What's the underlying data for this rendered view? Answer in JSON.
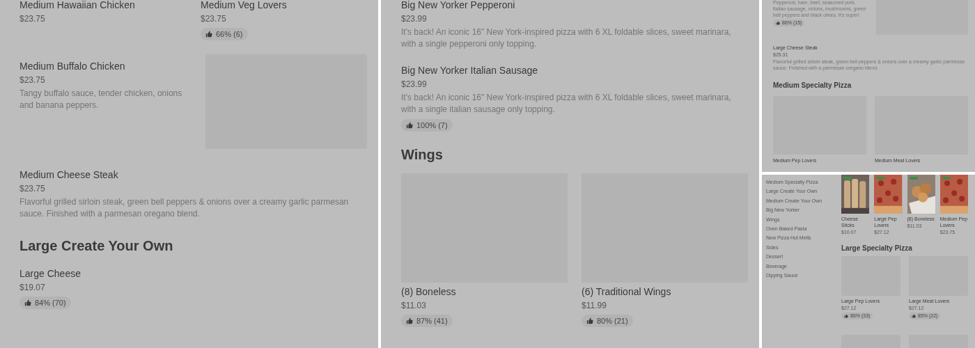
{
  "left_panel": {
    "blocks": [
      {
        "kind": "pair",
        "items": [
          {
            "name": "Medium Hawaiian Chicken",
            "price": "$23.75"
          },
          {
            "name": "Medium Veg Lovers",
            "price": "$23.75",
            "rating": "66% (6)"
          }
        ]
      },
      {
        "kind": "item_with_image",
        "name": "Medium Buffalo Chicken",
        "price": "$23.75",
        "description": "Tangy buffalo sauce, tender chicken, onions and banana peppers."
      },
      {
        "kind": "item",
        "name": "Medium Cheese Steak",
        "price": "$23.75",
        "description": "Flavorful grilled sirloin steak, green bell peppers & onions over a creamy garlic parmesan sauce. Finished with a parmesan oregano blend."
      },
      {
        "kind": "heading",
        "text": "Large Create Your Own"
      },
      {
        "kind": "item",
        "name": "Large Cheese",
        "price": "$19.07",
        "rating": "84% (70)"
      }
    ]
  },
  "middle_panel": {
    "blocks": [
      {
        "kind": "item",
        "name": "Big New Yorker Pepperoni",
        "price": "$23.99",
        "description": "It's back! An iconic 16\" New York-inspired pizza with 6 XL foldable slices, sweet marinara, with a single pepperoni only topping."
      },
      {
        "kind": "item",
        "name": "Big New Yorker Italian Sausage",
        "price": "$23.99",
        "description": "It's back! An iconic 16\" New York-inspired pizza with 6 XL foldable slices, sweet marinara, with a single italian sausage only topping.",
        "rating": "100% (7)"
      },
      {
        "kind": "heading",
        "text": "Wings"
      },
      {
        "kind": "grid",
        "cards": [
          {
            "name": "(8) Boneless",
            "price": "$11.03",
            "rating": "87% (41)"
          },
          {
            "name": "(6) Traditional Wings",
            "price": "$11.99",
            "rating": "80% (21)"
          }
        ]
      }
    ]
  },
  "top_right_panel": {
    "blocks": [
      {
        "kind": "item_with_image",
        "description": "Pepperoni, ham, beef, seasoned pork, italian sausage, onions, mushrooms, green bell peppers and black olives. It's super!",
        "rating": "86% (15)"
      },
      {
        "kind": "item",
        "name": "Large Cheese Steak",
        "price": "$25.31",
        "description": "Flavorful grilled sirloin steak, green bell peppers & onions over a creamy garlic parmesan sauce. Finished with a parmesan oregano blend."
      },
      {
        "kind": "heading",
        "text": "Medium Specialty Pizza"
      },
      {
        "kind": "grid",
        "cards": [
          {
            "name": "Medium Pep Lovers"
          },
          {
            "name": "Medium Meat Lovers"
          }
        ]
      }
    ]
  },
  "bottom_right_panel": {
    "sidebar": [
      "Medium Specialty Pizza",
      "Large Create Your Own",
      "Medium Create Your Own",
      "Big New Yorker",
      "Wings",
      "Oven Baked Pasta",
      "New Pizza Hut Melts",
      "Sides",
      "Dessert",
      "Beverage",
      "Dipping Sauce"
    ],
    "blocks": [
      {
        "kind": "row",
        "cards": [
          {
            "name": "Cheese Sticks",
            "price": "$10.07"
          },
          {
            "name": "Large Pep Lovers",
            "price": "$27.12"
          },
          {
            "name": "(8) Boneless",
            "price": "$11.03"
          },
          {
            "name": "Medium Pep Lovers",
            "price": "$23.75"
          }
        ]
      },
      {
        "kind": "heading",
        "text": "Large Specialty Pizza"
      },
      {
        "kind": "grid",
        "cards": [
          {
            "name": "Large Pep Lovers",
            "price": "$27.12",
            "rating": "86% (33)"
          },
          {
            "name": "Large Meat Lovers",
            "price": "$27.12",
            "rating": "85% (22)"
          }
        ]
      },
      {
        "kind": "image_row"
      }
    ]
  }
}
